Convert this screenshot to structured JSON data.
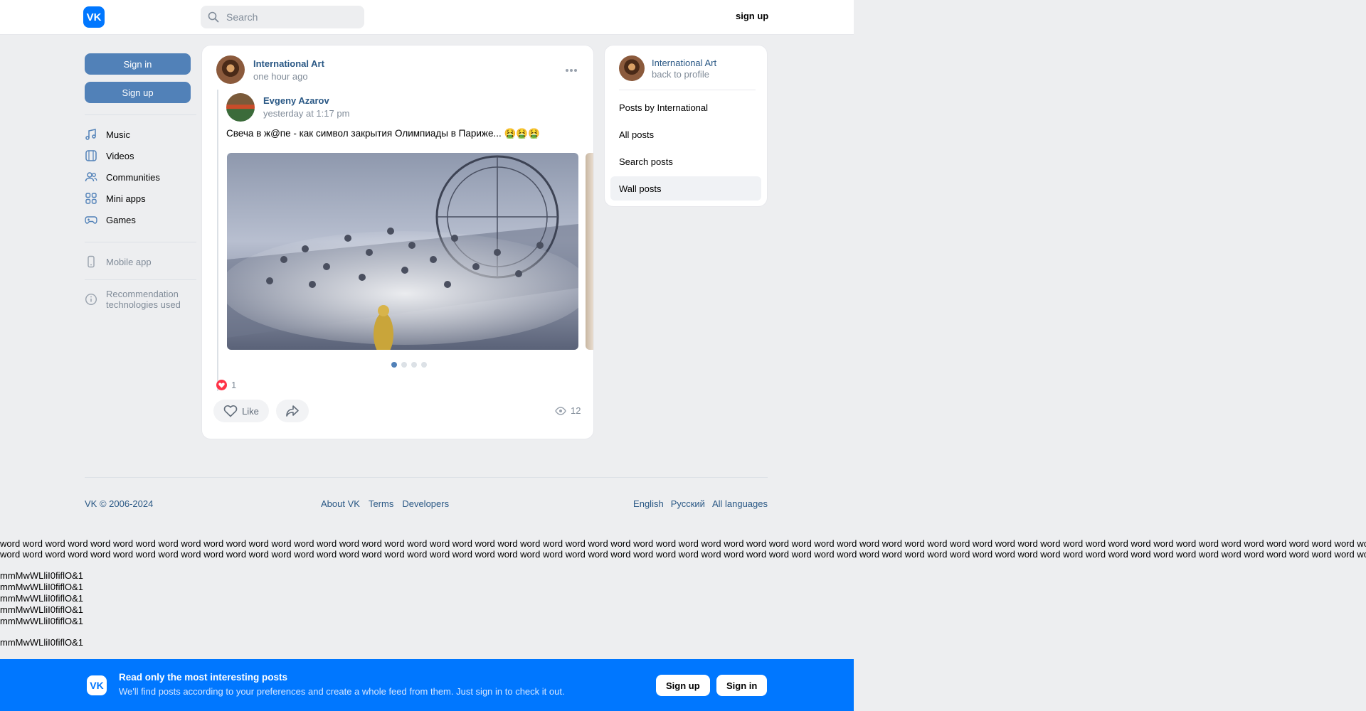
{
  "header": {
    "logo_text": "VK",
    "search_placeholder": "Search",
    "signup_link": "sign up"
  },
  "left_nav": {
    "sign_in": "Sign in",
    "sign_up": "Sign up",
    "items": [
      {
        "label": "Music",
        "icon": "music-icon"
      },
      {
        "label": "Videos",
        "icon": "videos-icon"
      },
      {
        "label": "Communities",
        "icon": "communities-icon"
      },
      {
        "label": "Mini apps",
        "icon": "mini-apps-icon"
      },
      {
        "label": "Games",
        "icon": "games-icon"
      }
    ],
    "mobile_app": "Mobile app",
    "recommendation": "Recommendation technologies used"
  },
  "post": {
    "group_name": "International Art",
    "time": "one hour ago",
    "repost_author": "Evgeny Azarov",
    "repost_time": "yesterday at 1:17 pm",
    "text": "Свеча в ж@пе - как символ закрытия Олимпиады в Париже... 🤮🤮🤮",
    "photo_count": 4,
    "active_photo": 1,
    "reaction_count": "1",
    "like_label": "Like",
    "views": "12"
  },
  "right_card": {
    "title": "International Art",
    "subtitle": "back to profile",
    "items": [
      {
        "label": "Posts by International",
        "active": false
      },
      {
        "label": "All posts",
        "active": false
      },
      {
        "label": "Search posts",
        "active": false
      },
      {
        "label": "Wall posts",
        "active": true
      }
    ]
  },
  "footer": {
    "copyright": "VK © 2006-2024",
    "links": [
      "About VK",
      "Terms",
      "Developers"
    ],
    "languages": [
      "English",
      "Русский",
      "All languages"
    ]
  },
  "test_text": {
    "words_line": "word word word word word word word word word word word word word word word word word word word word word word word word word word word word word word word word word word word word word word word word word word word word word word word word word word word word word word word word word word word word word word word word word word word word word word word word word word word word word",
    "lines": [
      "mmMwWLliI0fiflO&1",
      "mmMwWLliI0fiflO&1",
      "mmMwWLliI0fiflO&1",
      "mmMwWLliI0fiflO&1",
      "mmMwWLliI0fiflO&1",
      "mmMwWLliI0fiflO&1"
    ]
  },
  "banner": {
    "title": "Read only the most interesting posts",
    "subtitle": "We'll find posts according to your preferences and create a whole feed from them. Just sign in to check it out.",
    "sign_up": "Sign up",
    "sign_in": "Sign in"
  },
  "colors": {
    "brand": "#0077ff",
    "link": "#2a5885",
    "button": "#5181b8",
    "background": "#edeef0"
  }
}
